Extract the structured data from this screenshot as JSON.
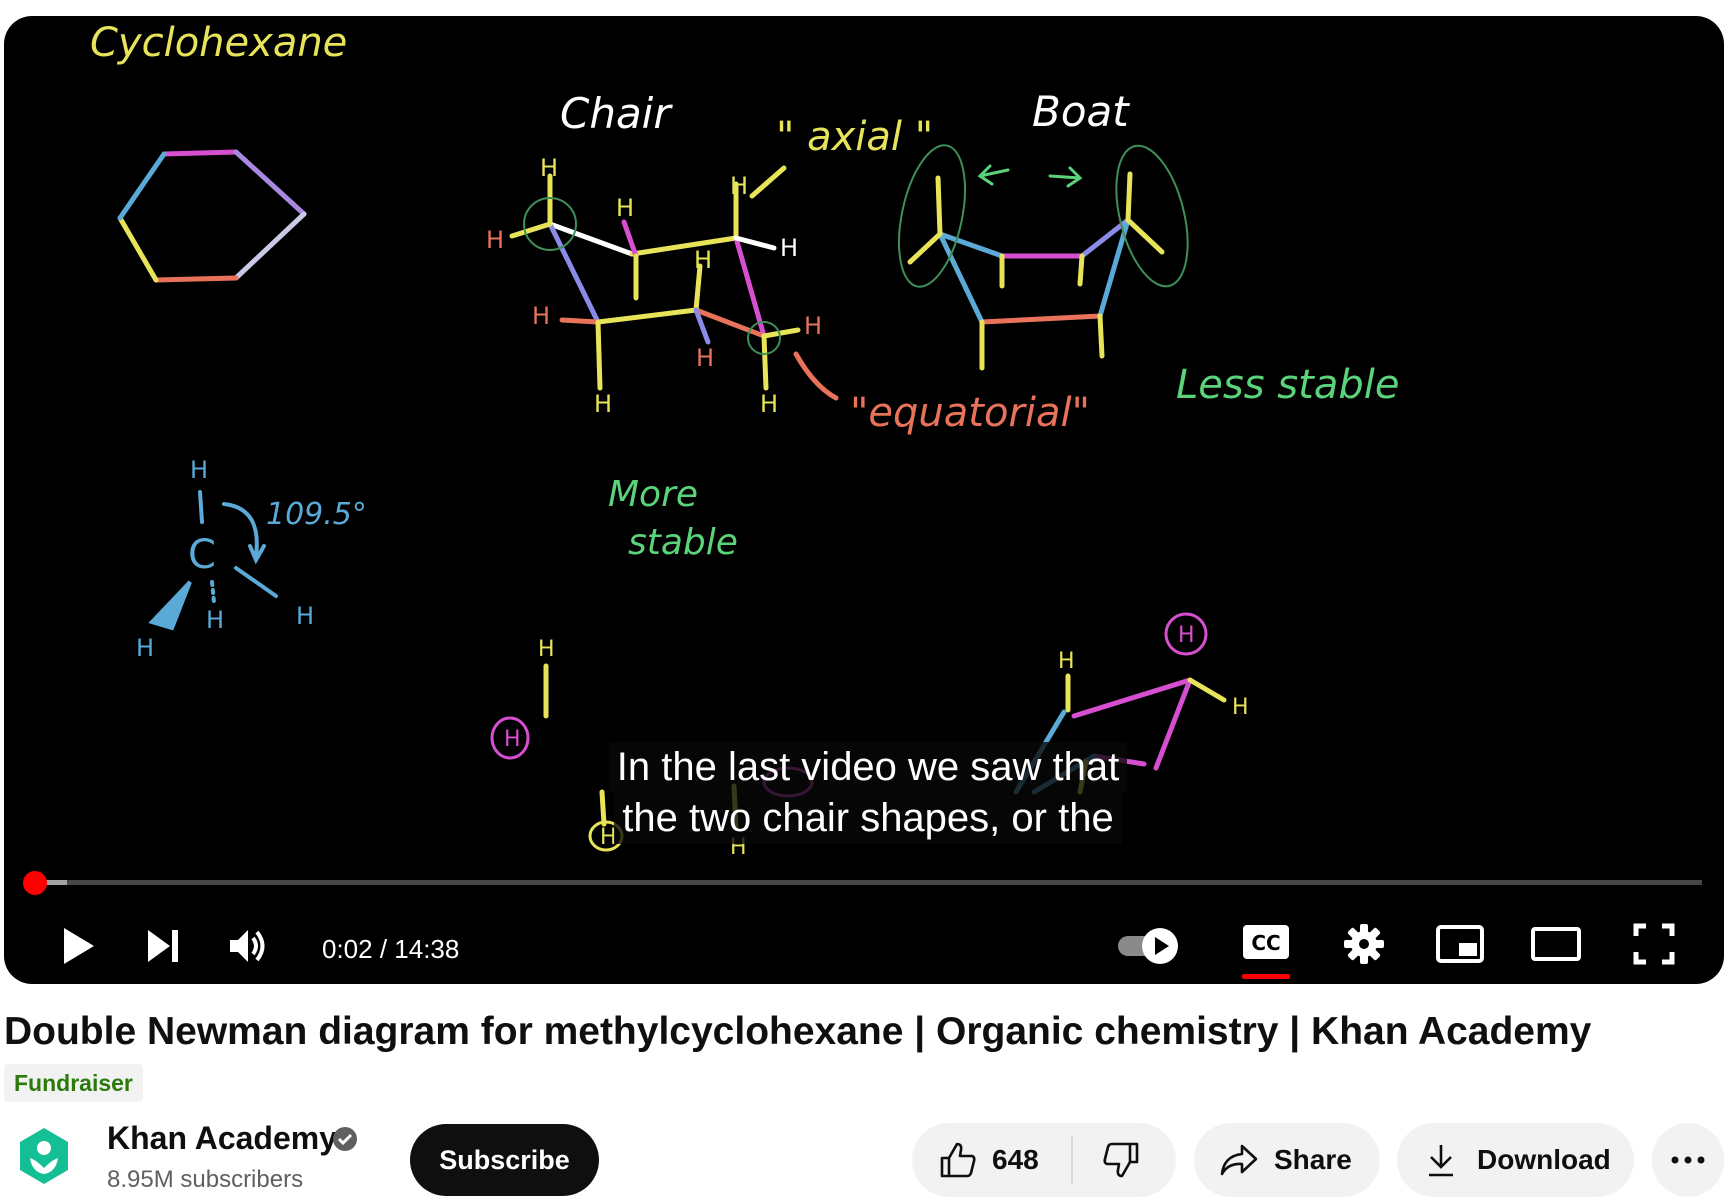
{
  "player": {
    "caption_line1": "In the last video we saw that",
    "caption_line2": "the two chair shapes, or the",
    "time_display": "0:02 / 14:38",
    "progress_fraction": 0.002,
    "controls": {
      "play": "play-icon",
      "next": "skip-next-icon",
      "volume": "volume-icon",
      "autoplay": "autoplay-toggle",
      "captions": "closed-captions-icon",
      "settings": "settings-gear-icon",
      "miniplayer": "miniplayer-icon",
      "theater": "theater-mode-icon",
      "fullscreen": "fullscreen-icon"
    },
    "board_text": {
      "title": "Cyclohexane",
      "chair": "Chair",
      "boat": "Boat",
      "axial": "\" axial \"",
      "equatorial": "\"equatorial\"",
      "less_stable": "Less stable",
      "more": "More",
      "stable": "stable",
      "angle": "109.5°",
      "carbon": "C",
      "h": "H"
    }
  },
  "video": {
    "title": "Double Newman diagram for methylcyclohexane | Organic chemistry | Khan Academy",
    "badge": "Fundraiser"
  },
  "channel": {
    "name": "Khan Academy",
    "subscribers": "8.95M subscribers",
    "subscribe_label": "Subscribe",
    "verified_icon": "verified-check-icon"
  },
  "actions": {
    "likes": "648",
    "share_label": "Share",
    "download_label": "Download",
    "more_icon": "more-horizontal-icon"
  },
  "colors": {
    "player_bg": "#000000",
    "progress": "#ff0000",
    "chalk_yellow": "#e8e45a",
    "chalk_green": "#5bd37a",
    "chalk_magenta": "#d64fd0",
    "chalk_blue": "#5aa9d6",
    "chalk_orange": "#e8735a",
    "badge_green": "#2b7a0b"
  }
}
